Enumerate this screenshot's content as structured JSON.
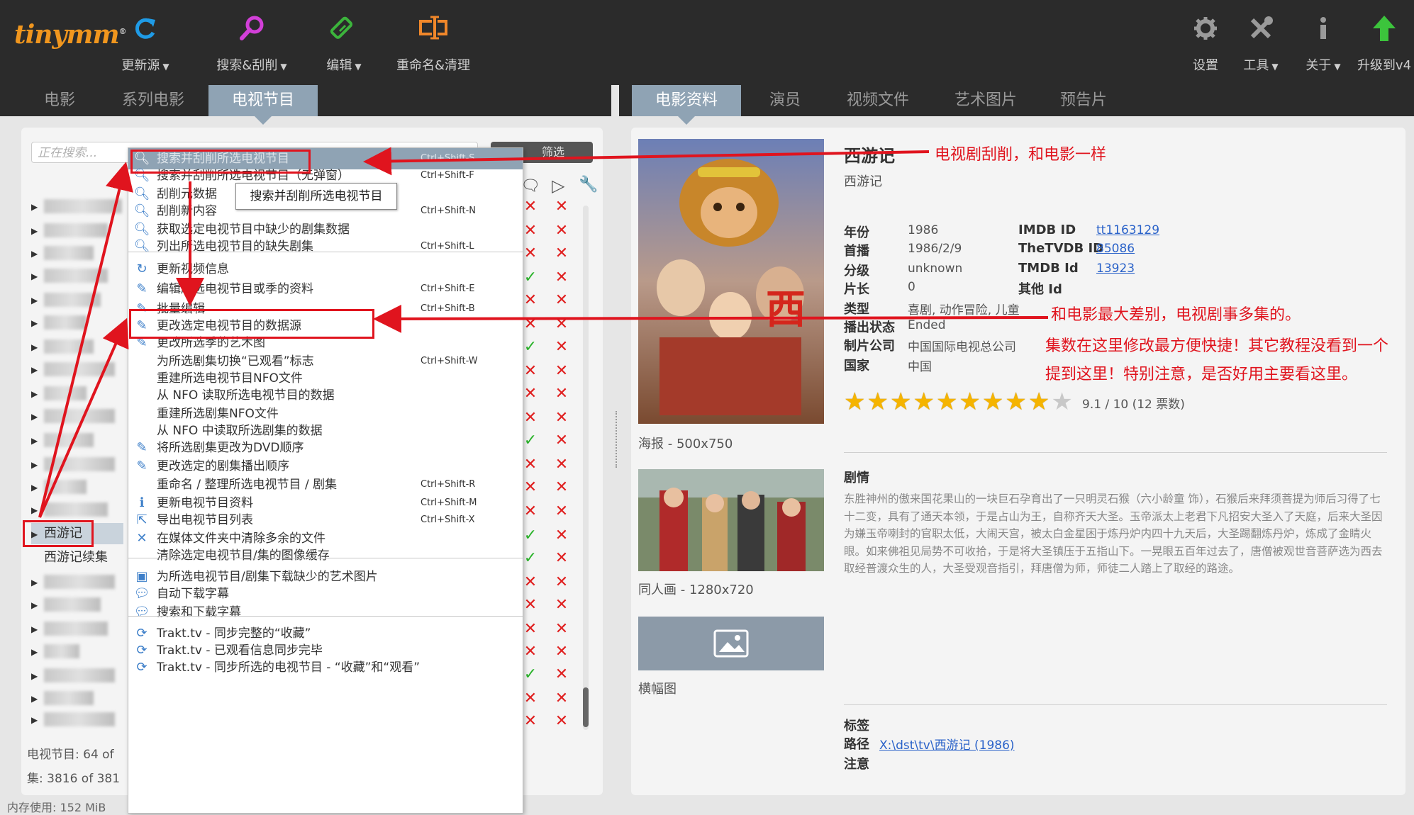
{
  "app": {
    "logo": "tinymm",
    "logo_mark": "®"
  },
  "toolbar": {
    "left": [
      {
        "label": "更新源",
        "icon": "refresh-icon",
        "dropdown": true
      },
      {
        "label": "搜索&刮削",
        "icon": "search-icon",
        "dropdown": true
      },
      {
        "label": "编辑",
        "icon": "edit-icon",
        "dropdown": true
      },
      {
        "label": "重命名&清理",
        "icon": "rename-icon",
        "dropdown": false
      }
    ],
    "right": [
      {
        "label": "设置",
        "icon": "gear-icon",
        "dropdown": false
      },
      {
        "label": "工具",
        "icon": "tools-icon",
        "dropdown": true
      },
      {
        "label": "关于",
        "icon": "info-icon",
        "dropdown": true
      },
      {
        "label": "升级到v4",
        "icon": "upgrade-arrow-icon",
        "dropdown": false
      }
    ]
  },
  "left_tabs": [
    "电影",
    "系列电影",
    "电视节目"
  ],
  "right_tabs": [
    "电影资料",
    "演员",
    "视频文件",
    "艺术图片",
    "预告片"
  ],
  "search": {
    "placeholder": "正在搜索...",
    "filter_label": "筛选"
  },
  "tree": {
    "selected": "西游记",
    "next": "西游记续集",
    "status_line1": "电视节目:  64  of",
    "status_line2": "集:  3816  of  381",
    "memory": "内存使用:  152 MiB"
  },
  "context_menu": {
    "items": [
      {
        "label": "搜索并刮削所选电视节目",
        "shortcut": "Ctrl+Shift-S",
        "icon": "search-icon"
      },
      {
        "label": "搜索并刮削所选电视节目（无弹窗）",
        "shortcut": "Ctrl+Shift-F",
        "icon": "search-icon"
      },
      {
        "label": "刮削元数据",
        "shortcut": "",
        "icon": "search-icon"
      },
      {
        "label": "刮削新内容",
        "shortcut": "Ctrl+Shift-N",
        "icon": "search-icon"
      },
      {
        "label": "获取选定电视节目中缺少的剧集数据",
        "shortcut": "",
        "icon": "search-icon"
      },
      {
        "label": "列出所选电视节目的缺失剧集",
        "shortcut": "Ctrl+Shift-L",
        "icon": "search-icon"
      },
      {
        "label": "更新视频信息",
        "shortcut": "",
        "icon": "refresh-icon"
      },
      {
        "label": "编辑所选电视节目或季的资料",
        "shortcut": "Ctrl+Shift-E",
        "icon": "edit-icon"
      },
      {
        "label": "批量编辑",
        "shortcut": "Ctrl+Shift-B",
        "icon": "edit-icon"
      },
      {
        "label": "更改选定电视节目的数据源",
        "shortcut": "",
        "icon": "edit-icon"
      },
      {
        "label": "更改所选季的艺术图",
        "shortcut": "",
        "icon": "edit-icon"
      },
      {
        "label": "为所选剧集切换“已观看”标志",
        "shortcut": "Ctrl+Shift-W",
        "icon": ""
      },
      {
        "label": "重建所选电视节目NFO文件",
        "shortcut": "",
        "icon": ""
      },
      {
        "label": "从 NFO 读取所选电视节目的数据",
        "shortcut": "",
        "icon": ""
      },
      {
        "label": "重建所选剧集NFO文件",
        "shortcut": "",
        "icon": ""
      },
      {
        "label": "从 NFO 中读取所选剧集的数据",
        "shortcut": "",
        "icon": ""
      },
      {
        "label": "将所选剧集更改为DVD顺序",
        "shortcut": "",
        "icon": "edit-icon"
      },
      {
        "label": "更改选定的剧集播出顺序",
        "shortcut": "",
        "icon": "edit-icon"
      },
      {
        "label": "重命名 / 整理所选电视节目 / 剧集",
        "shortcut": "Ctrl+Shift-R",
        "icon": ""
      },
      {
        "label": "更新电视节目资料",
        "shortcut": "Ctrl+Shift-M",
        "icon": "info-icon"
      },
      {
        "label": "导出电视节目列表",
        "shortcut": "Ctrl+Shift-X",
        "icon": "export-icon"
      },
      {
        "label": "在媒体文件夹中清除多余的文件",
        "shortcut": "",
        "icon": "close-icon"
      },
      {
        "label": "清除选定电视节目/集的图像缓存",
        "shortcut": "",
        "icon": ""
      },
      {
        "label": "为所选电视节目/剧集下载缺少的艺术图片",
        "shortcut": "",
        "icon": "image-icon"
      },
      {
        "label": "自动下载字幕",
        "shortcut": "",
        "icon": "subtitle-icon"
      },
      {
        "label": "搜索和下载字幕",
        "shortcut": "",
        "icon": "subtitle-icon"
      },
      {
        "label": "Trakt.tv - 同步完整的“收藏”",
        "shortcut": "",
        "icon": "sync-icon"
      },
      {
        "label": "Trakt.tv - 已观看信息同步完毕",
        "shortcut": "",
        "icon": "sync-icon"
      },
      {
        "label": "Trakt.tv - 同步所选的电视节目 - “收藏”和“观看”",
        "shortcut": "",
        "icon": "sync-icon"
      }
    ],
    "tooltip": "搜索并刮削所选电视节目"
  },
  "detail": {
    "title": "西游记",
    "original_title": "西游记",
    "fields_left": [
      {
        "key": "年份",
        "value": "1986"
      },
      {
        "key": "首播",
        "value": "1986/2/9"
      },
      {
        "key": "分级",
        "value": "unknown"
      },
      {
        "key": "片长",
        "value": "0"
      },
      {
        "key": "类型",
        "value": "喜剧, 动作冒险, 儿童"
      },
      {
        "key": "播出状态",
        "value": "Ended"
      },
      {
        "key": "制片公司",
        "value": "中国国际电视总公司"
      },
      {
        "key": "国家",
        "value": "中国"
      }
    ],
    "fields_right": [
      {
        "key": "IMDB ID",
        "value": "tt1163129"
      },
      {
        "key": "TheTVDB ID",
        "value": "85086"
      },
      {
        "key": "TMDB Id",
        "value": "13923"
      },
      {
        "key": "其他 Id",
        "value": ""
      }
    ],
    "rating_value": 9.1,
    "rating_text": "9.1 / 10  (12 票数)",
    "plot_heading": "剧情",
    "plot": "东胜神州的傲来国花果山的一块巨石孕育出了一只明灵石猴（六小龄童 饰），石猴后来拜须菩提为师后习得了七十二变，具有了通天本领，于是占山为王，自称齐天大圣。玉帝派太上老君下凡招安大圣入了天庭，后来大圣因为嫌玉帝喇封的官职太低，大闹天宫，被太白金星困于炼丹炉内四十九天后，大圣踢翻炼丹炉，炼成了金睛火眼。如来佛祖见局势不可收拾，于是将大圣镇压于五指山下。一晃眼五百年过去了，唐僧被观世音菩萨选为西去取经普渡众生的人，大圣受观音指引，拜唐僧为师，师徒二人踏上了取经的路途。",
    "poster_caption": "海报 - 500x750",
    "fanart_caption": "同人画 - 1280x720",
    "banner_caption": "横幅图",
    "tags_label": "标签",
    "path_label": "路径",
    "path_value": "X:\\dst\\tv\\西游记 (1986)",
    "note_label": "注意"
  },
  "annotations": {
    "a1": "电视剧刮削，和电影一样",
    "a2": "和电影最大差别，电视剧事多集的。",
    "a3": "集数在这里修改最方便快捷！其它教程没看到一个",
    "a4": "提到这里！特别注意，是否好用主要看这里。"
  },
  "colors": {
    "accent": "#8fa3b4",
    "annotation": "#e0141e",
    "toolbar": "#2b2b2b",
    "link": "#2a62c9"
  }
}
